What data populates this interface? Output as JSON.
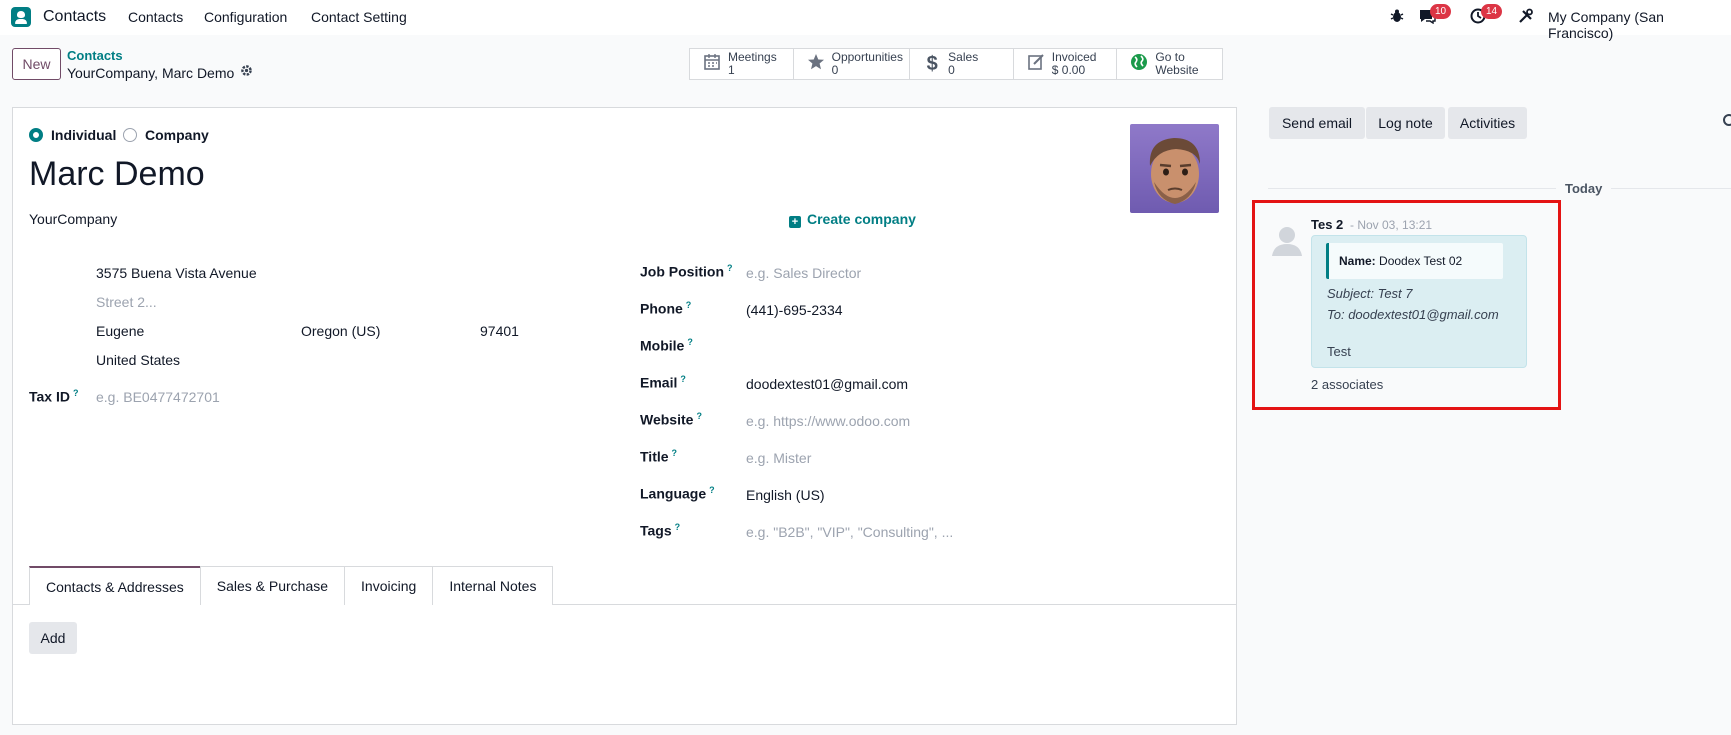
{
  "navbar": {
    "app_name": "Contacts",
    "menu": [
      "Contacts",
      "Configuration",
      "Contact Setting"
    ],
    "messages_badge": "10",
    "activities_badge": "14",
    "company": "My Company (San Francisco)"
  },
  "control": {
    "new_label": "New",
    "breadcrumb_parent": "Contacts",
    "breadcrumb_current": "YourCompany, Marc Demo"
  },
  "stats": [
    {
      "icon": "calendar-icon",
      "label": "Meetings",
      "value": "1"
    },
    {
      "icon": "star-icon",
      "label": "Opportunities",
      "value": "0"
    },
    {
      "icon": "dollar-icon",
      "label": "Sales",
      "value": "0"
    },
    {
      "icon": "invoice-icon",
      "label": "Invoiced",
      "value": "$ 0.00"
    },
    {
      "icon": "globe-icon",
      "label": "Go to",
      "value": "Website"
    }
  ],
  "form": {
    "type_individual": "Individual",
    "type_company": "Company",
    "name": "Marc Demo",
    "company": "YourCompany",
    "create_company": "Create company",
    "street": "3575  Buena Vista Avenue",
    "street2_placeholder": "Street 2...",
    "city": "Eugene",
    "state": "Oregon (US)",
    "zip": "97401",
    "country": "United States",
    "tax_id_label": "Tax ID",
    "tax_id_placeholder": "e.g. BE0477472701",
    "job_position_label": "Job Position",
    "job_position_placeholder": "e.g. Sales Director",
    "phone_label": "Phone",
    "phone": "(441)-695-2334",
    "mobile_label": "Mobile",
    "email_label": "Email",
    "email": "doodextest01@gmail.com",
    "website_label": "Website",
    "website_placeholder": "e.g. https://www.odoo.com",
    "title_label": "Title",
    "title_placeholder": "e.g. Mister",
    "language_label": "Language",
    "language": "English (US)",
    "tags_label": "Tags",
    "tags_placeholder": "e.g. \"B2B\", \"VIP\", \"Consulting\", ..."
  },
  "tabs": [
    "Contacts & Addresses",
    "Sales & Purchase",
    "Invoicing",
    "Internal Notes"
  ],
  "add_label": "Add",
  "chatter": {
    "send_email": "Send email",
    "log_note": "Log note",
    "activities": "Activities",
    "today": "Today",
    "message": {
      "author": "Tes 2",
      "date": "- Nov 03, 13:21",
      "name_label": "Name:",
      "name_value": "Doodex Test 02",
      "subject": "Subject: Test 7",
      "to": "To: doodextest01@gmail.com",
      "body": "Test",
      "associates": "2 associates"
    }
  },
  "colors": {
    "accent": "#017e84",
    "brand": "#714b67",
    "badge": "#dc3545",
    "highlight": "#e41313"
  }
}
